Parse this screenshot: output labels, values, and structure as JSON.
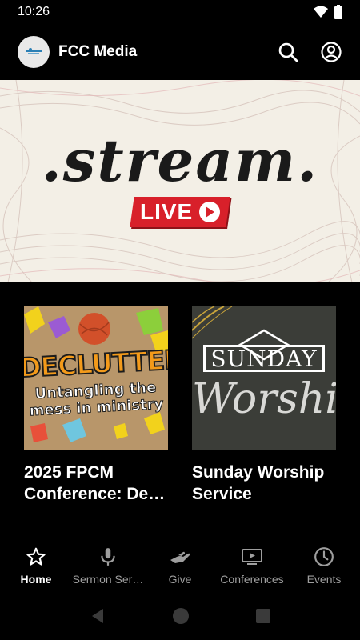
{
  "status_bar": {
    "time": "10:26"
  },
  "header": {
    "title": "FCC Media",
    "logo": "fcc-logo",
    "search_icon": "search-icon",
    "account_icon": "account-icon"
  },
  "hero": {
    "title": ".stream.",
    "badge": "LIVE",
    "badge_color": "#d8202a"
  },
  "cards": [
    {
      "title": "2025 FPCM Conference: De…",
      "art_headline": "DECLUTTER",
      "art_sub": "Untangling the mess in ministry"
    },
    {
      "title": "Sunday Worship Service",
      "art_headline": "SUNDAY",
      "art_sub": "Worship"
    }
  ],
  "bottom_nav": {
    "items": [
      {
        "label": "Home",
        "icon": "star-icon",
        "active": true
      },
      {
        "label": "Sermon Ser…",
        "icon": "microphone-icon",
        "active": false
      },
      {
        "label": "Give",
        "icon": "giving-hand-icon",
        "active": false
      },
      {
        "label": "Conferences",
        "icon": "video-icon",
        "active": false
      },
      {
        "label": "Events",
        "icon": "clock-icon",
        "active": false
      }
    ]
  },
  "colors": {
    "background": "#000000",
    "accent_live": "#d8202a",
    "inactive": "#9e9e9e"
  }
}
